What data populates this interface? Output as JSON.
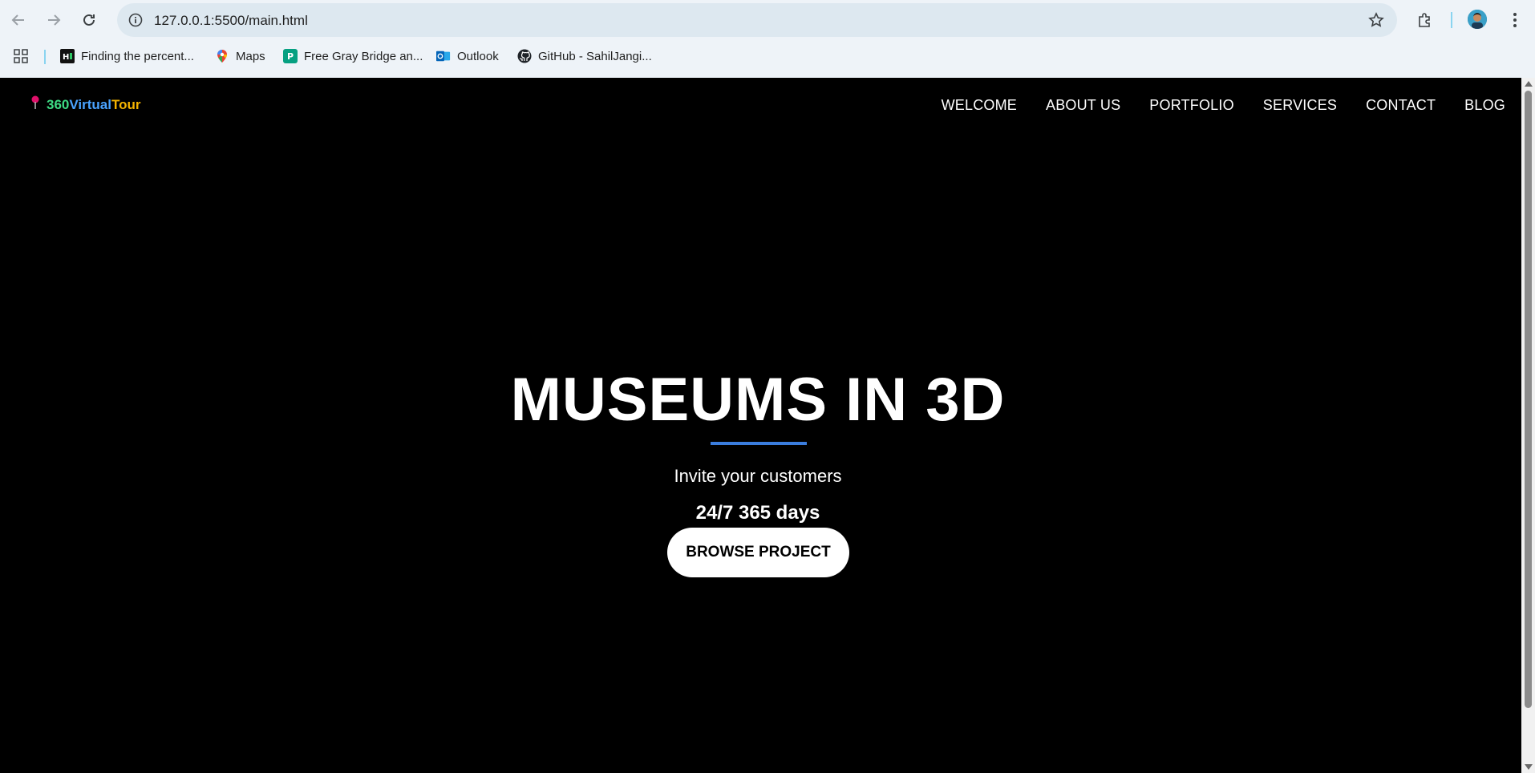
{
  "browser": {
    "url": "127.0.0.1:5500/main.html",
    "bookmarks": [
      {
        "label": "Finding the percent...",
        "icon": "hackerrank-icon"
      },
      {
        "label": "Maps",
        "icon": "maps-pin-icon"
      },
      {
        "label": "Free Gray Bridge an...",
        "icon": "pexels-icon"
      },
      {
        "label": "Outlook",
        "icon": "outlook-icon"
      },
      {
        "label": "GitHub - SahilJangi...",
        "icon": "github-icon"
      }
    ]
  },
  "site": {
    "logo": {
      "part1": "360",
      "part2": "Virtual",
      "part3": "Tour"
    },
    "nav": [
      "WELCOME",
      "ABOUT US",
      "PORTFOLIO",
      "SERVICES",
      "CONTACT",
      "BLOG"
    ],
    "hero": {
      "title": "MUSEUMS IN 3D",
      "subtitle": "Invite your customers",
      "tagline": "24/7 365 days",
      "button": "BROWSE PROJECT"
    }
  },
  "colors": {
    "accent_line": "#3b7ddd",
    "logo_green": "#3ddc84",
    "logo_blue": "#4aa3ff",
    "logo_yellow": "#f5b400",
    "pin": "#e0106a"
  }
}
